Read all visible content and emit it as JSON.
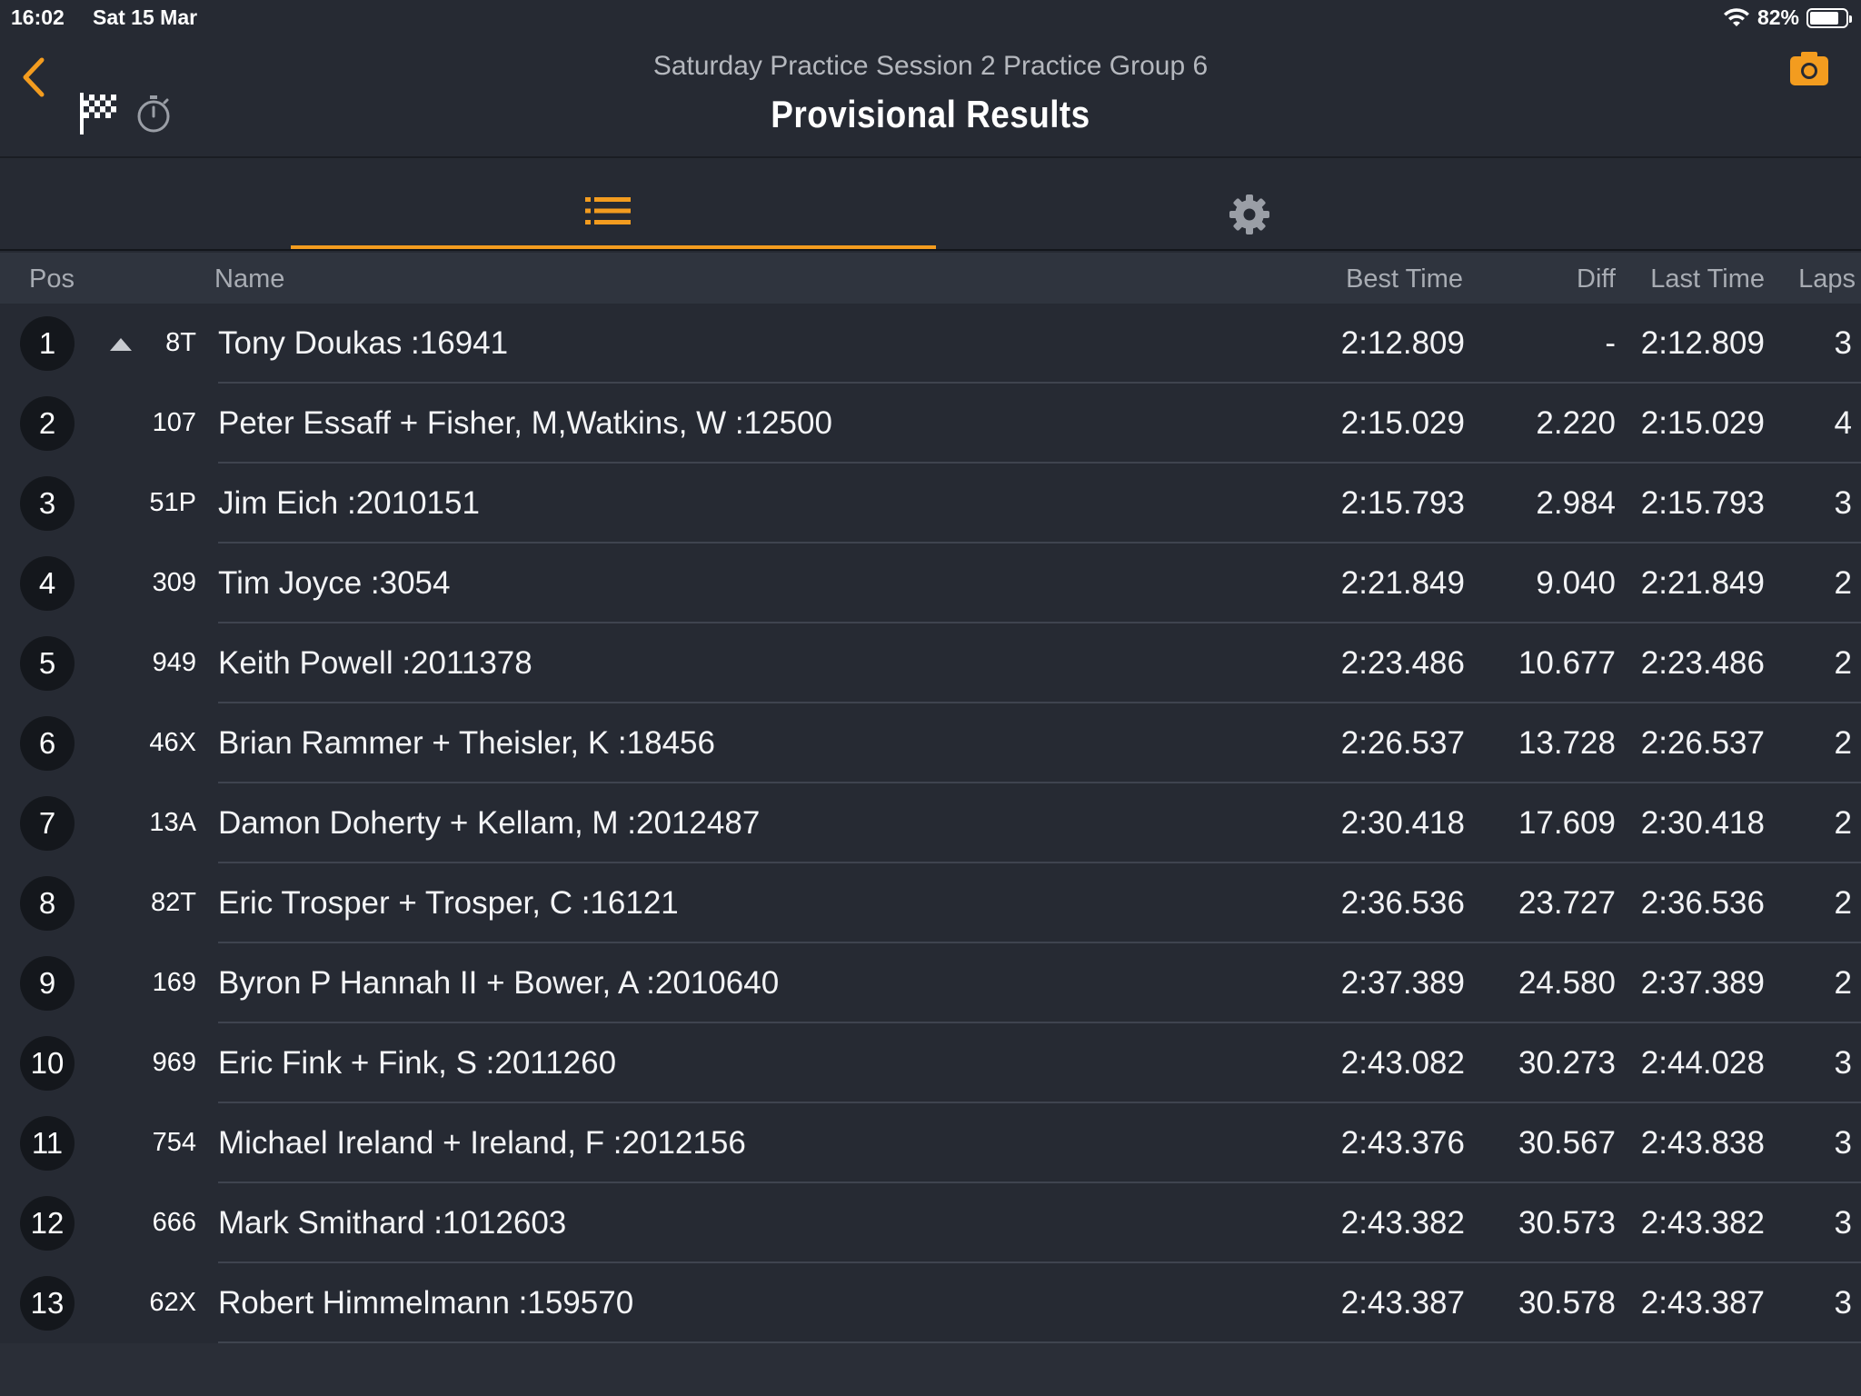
{
  "status_bar": {
    "time": "16:02",
    "date": "Sat 15 Mar",
    "battery": "82%",
    "battery_level": 0.82
  },
  "header": {
    "session_title": "Saturday Practice Session 2 Practice Group 6",
    "page_title": "Provisional Results"
  },
  "colors": {
    "accent": "#f39c1f",
    "background": "#262a33",
    "header_row": "#2f343e"
  },
  "icons": [
    "back-chevron-icon",
    "checkered-flag-icon",
    "stopwatch-icon",
    "camera-icon",
    "list-icon",
    "gear-icon"
  ],
  "table": {
    "columns": {
      "pos": "Pos",
      "name": "Name",
      "best": "Best Time",
      "diff": "Diff",
      "last": "Last Time",
      "laps": "Laps"
    },
    "rows": [
      {
        "pos": "1",
        "num": "8T",
        "name": "Tony Doukas :16941",
        "best": "2:12.809",
        "diff": "-",
        "last": "2:12.809",
        "laps": "3",
        "up": true
      },
      {
        "pos": "2",
        "num": "107",
        "name": "Peter Essaff + Fisher, M,Watkins, W :12500",
        "best": "2:15.029",
        "diff": "2.220",
        "last": "2:15.029",
        "laps": "4"
      },
      {
        "pos": "3",
        "num": "51P",
        "name": "Jim Eich :2010151",
        "best": "2:15.793",
        "diff": "2.984",
        "last": "2:15.793",
        "laps": "3"
      },
      {
        "pos": "4",
        "num": "309",
        "name": "Tim Joyce :3054",
        "best": "2:21.849",
        "diff": "9.040",
        "last": "2:21.849",
        "laps": "2"
      },
      {
        "pos": "5",
        "num": "949",
        "name": "Keith Powell :2011378",
        "best": "2:23.486",
        "diff": "10.677",
        "last": "2:23.486",
        "laps": "2"
      },
      {
        "pos": "6",
        "num": "46X",
        "name": "Brian Rammer + Theisler, K :18456",
        "best": "2:26.537",
        "diff": "13.728",
        "last": "2:26.537",
        "laps": "2"
      },
      {
        "pos": "7",
        "num": "13A",
        "name": "Damon Doherty + Kellam, M :2012487",
        "best": "2:30.418",
        "diff": "17.609",
        "last": "2:30.418",
        "laps": "2"
      },
      {
        "pos": "8",
        "num": "82T",
        "name": "Eric Trosper + Trosper, C :16121",
        "best": "2:36.536",
        "diff": "23.727",
        "last": "2:36.536",
        "laps": "2"
      },
      {
        "pos": "9",
        "num": "169",
        "name": "Byron P Hannah II + Bower, A :2010640",
        "best": "2:37.389",
        "diff": "24.580",
        "last": "2:37.389",
        "laps": "2"
      },
      {
        "pos": "10",
        "num": "969",
        "name": "Eric Fink + Fink, S :2011260",
        "best": "2:43.082",
        "diff": "30.273",
        "last": "2:44.028",
        "laps": "3"
      },
      {
        "pos": "11",
        "num": "754",
        "name": "Michael Ireland + Ireland, F :2012156",
        "best": "2:43.376",
        "diff": "30.567",
        "last": "2:43.838",
        "laps": "3"
      },
      {
        "pos": "12",
        "num": "666",
        "name": "Mark Smithard :1012603",
        "best": "2:43.382",
        "diff": "30.573",
        "last": "2:43.382",
        "laps": "3"
      },
      {
        "pos": "13",
        "num": "62X",
        "name": "Robert Himmelmann :159570",
        "best": "2:43.387",
        "diff": "30.578",
        "last": "2:43.387",
        "laps": "3"
      }
    ]
  }
}
